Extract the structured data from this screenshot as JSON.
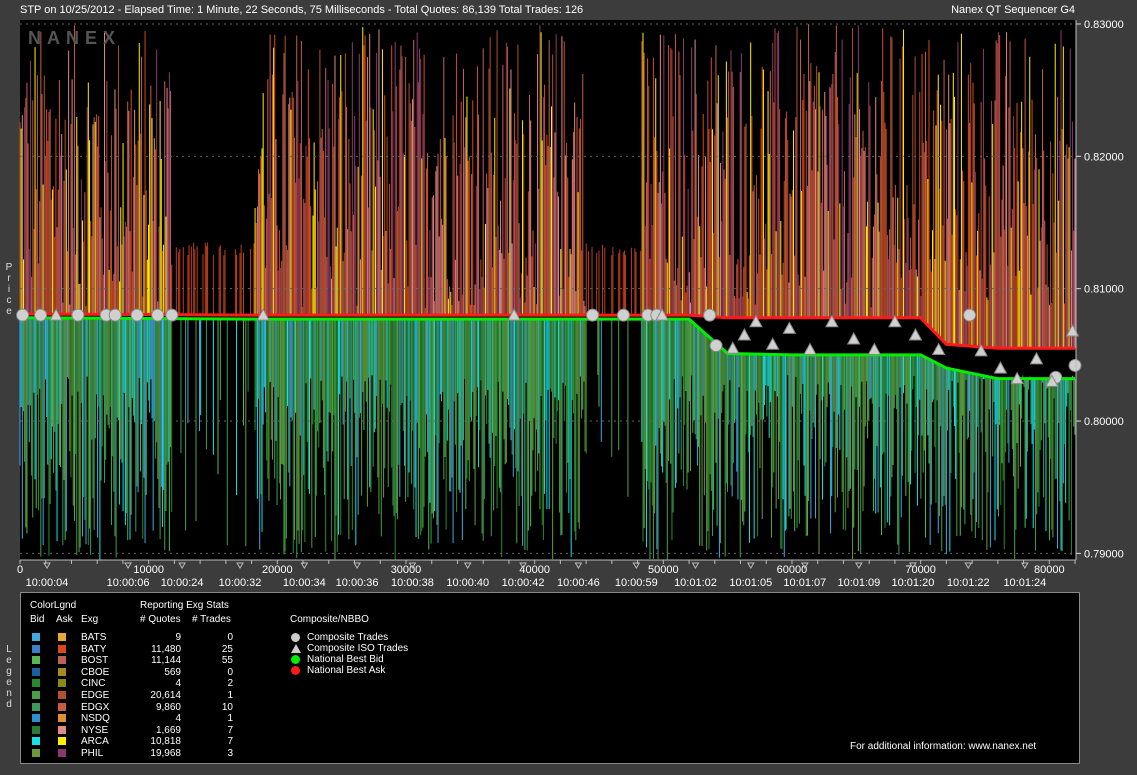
{
  "header": {
    "title_left": "STP on 10/25/2012  -  Elapsed Time: 1 Minute, 22 Seconds, 75 Milliseconds  -  Total Quotes: 86,139  Total Trades: 126",
    "title_right": "Nanex QT Sequencer G4",
    "watermark": "NANEX"
  },
  "chart_data": {
    "type": "area",
    "ylabel": "Price",
    "ylim": [
      0.7895,
      0.8303
    ],
    "xlim": [
      0,
      82075
    ],
    "y_ticks": [
      "0.83000",
      "0.82000",
      "0.81000",
      "0.80000",
      "0.79000"
    ],
    "y_tick_values": [
      0.83,
      0.82,
      0.81,
      0.8,
      0.79
    ],
    "x_ticks": [
      "0",
      "10000",
      "20000",
      "30000",
      "40000",
      "50000",
      "60000",
      "70000",
      "80000"
    ],
    "x_tick_values": [
      0,
      10000,
      20000,
      30000,
      40000,
      50000,
      60000,
      70000,
      80000
    ],
    "time_labels": [
      "10:00:04",
      "10:00:06",
      "10:00:24",
      "10:00:32",
      "10:00:34",
      "10:00:36",
      "10:00:38",
      "10:00:40",
      "10:00:42",
      "10:00:46",
      "10:00:59",
      "10:01:02",
      "10:01:05",
      "10:01:07",
      "10:01:09",
      "10:01:20",
      "10:01:22",
      "10:01:24"
    ],
    "time_label_x": [
      2100,
      8400,
      12600,
      17100,
      22100,
      26200,
      30500,
      34800,
      39100,
      43400,
      47900,
      52500,
      56800,
      61000,
      65200,
      69400,
      73700,
      78100
    ],
    "series": [
      {
        "name": "National Best Ask",
        "color": "#ff1a1a",
        "x": [
          0,
          18000,
          44000,
          50000,
          52000,
          55000,
          60000,
          65000,
          70000,
          72000,
          76000,
          82000
        ],
        "y": [
          0.8081,
          0.808,
          0.808,
          0.808,
          0.808,
          0.8078,
          0.8078,
          0.8078,
          0.8078,
          0.8058,
          0.8055,
          0.8055
        ]
      },
      {
        "name": "National Best Bid",
        "color": "#00ee00",
        "x": [
          0,
          18000,
          44000,
          50000,
          52000,
          55000,
          60000,
          65000,
          70000,
          72000,
          76000,
          82000
        ],
        "y": [
          0.8078,
          0.8077,
          0.8077,
          0.8077,
          0.8077,
          0.8051,
          0.805,
          0.805,
          0.805,
          0.804,
          0.8032,
          0.8032
        ]
      }
    ],
    "composite_trades_x": [
      200,
      1600,
      4500,
      6700,
      7400,
      9100,
      10700,
      11800,
      44500,
      46900,
      48800,
      49500,
      53600,
      54100,
      73800,
      80500,
      82000
    ],
    "composite_trades_y": [
      0.808,
      0.808,
      0.808,
      0.808,
      0.808,
      0.808,
      0.808,
      0.808,
      0.808,
      0.808,
      0.808,
      0.808,
      0.808,
      0.8057,
      0.808,
      0.8033,
      0.8042
    ],
    "iso_trades_x": [
      2800,
      18900,
      38400,
      49900,
      55400,
      56300,
      57200,
      58500,
      59800,
      61400,
      63100,
      64800,
      66400,
      68000,
      69600,
      71400,
      74700,
      76200,
      77500,
      79000,
      80200,
      81800
    ],
    "iso_trades_y": [
      0.808,
      0.808,
      0.808,
      0.808,
      0.8055,
      0.8065,
      0.8075,
      0.8058,
      0.807,
      0.8054,
      0.8075,
      0.8062,
      0.8054,
      0.8075,
      0.8065,
      0.8054,
      0.8053,
      0.804,
      0.8032,
      0.8047,
      0.803,
      0.8068
    ]
  },
  "legend": {
    "side_label": "Legend",
    "color_legend_heading": "ColorLgnd",
    "col_bid": "Bid",
    "col_ask": "Ask",
    "col_exg": "Exg",
    "stats_heading": "Reporting Exg Stats",
    "col_quotes": "# Quotes",
    "col_trades": "# Trades",
    "composite_heading": "Composite/NBBO",
    "composite_items": [
      {
        "label": "Composite Trades",
        "marker": "circle",
        "color": "#cccccc"
      },
      {
        "label": "Composite ISO Trades",
        "marker": "triangle",
        "color": "#cccccc"
      },
      {
        "label": "National Best Bid",
        "marker": "circle",
        "color": "#00ee00"
      },
      {
        "label": "National Best Ask",
        "marker": "circle",
        "color": "#ff1a1a"
      }
    ],
    "footer": "For additional information: www.nanex.net",
    "exchanges": [
      {
        "exg": "BATS",
        "bid_color": "#3fa9e0",
        "ask_color": "#e8a838",
        "quotes": "9",
        "trades": "0"
      },
      {
        "exg": "BATY",
        "bid_color": "#3b7fc4",
        "ask_color": "#d84a1a",
        "quotes": "11,480",
        "trades": "25"
      },
      {
        "exg": "BOST",
        "bid_color": "#55b855",
        "ask_color": "#c0605a",
        "quotes": "11,144",
        "trades": "55"
      },
      {
        "exg": "CBOE",
        "bid_color": "#1a5fa0",
        "ask_color": "#a88a20",
        "quotes": "569",
        "trades": "0"
      },
      {
        "exg": "CINC",
        "bid_color": "#2a8a2a",
        "ask_color": "#8a8a18",
        "quotes": "4",
        "trades": "2"
      },
      {
        "exg": "EDGE",
        "bid_color": "#4aa04a",
        "ask_color": "#b05030",
        "quotes": "20,614",
        "trades": "1"
      },
      {
        "exg": "EDGX",
        "bid_color": "#3c9a5c",
        "ask_color": "#c85a48",
        "quotes": "9,860",
        "trades": "10"
      },
      {
        "exg": "NSDQ",
        "bid_color": "#2a90d0",
        "ask_color": "#e09030",
        "quotes": "4",
        "trades": "1"
      },
      {
        "exg": "NYSE",
        "bid_color": "#2a7a3a",
        "ask_color": "#e08a8a",
        "quotes": "1,669",
        "trades": "7"
      },
      {
        "exg": "ARCA",
        "bid_color": "#18e0e8",
        "ask_color": "#ffee00",
        "quotes": "10,818",
        "trades": "7"
      },
      {
        "exg": "PHIL",
        "bid_color": "#6a9a3a",
        "ask_color": "#8a3a6a",
        "quotes": "19,968",
        "trades": "3"
      }
    ]
  }
}
